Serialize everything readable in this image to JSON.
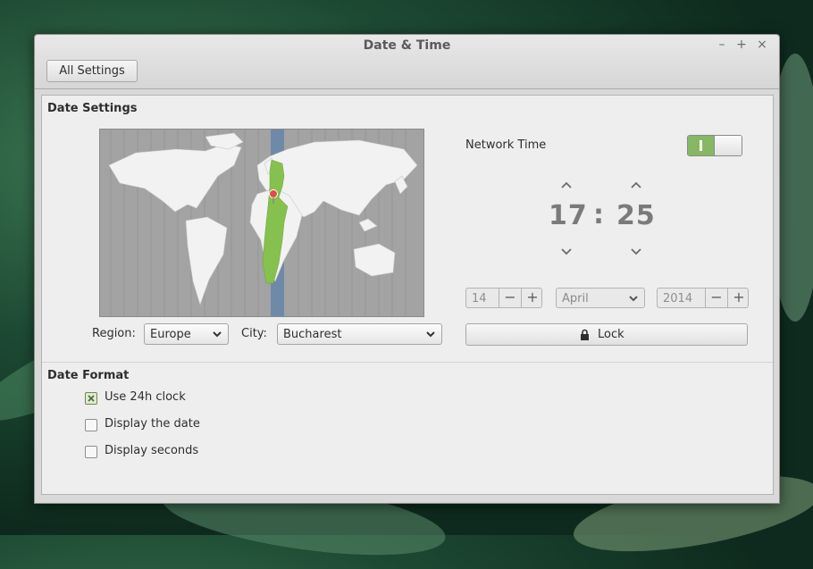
{
  "window": {
    "title": "Date & Time",
    "controls": {
      "minimize": "–",
      "maximize": "+",
      "close": "×"
    }
  },
  "header": {
    "all_settings_label": "All Settings"
  },
  "date_settings": {
    "title": "Date Settings",
    "region_label": "Region:",
    "region_value": "Europe",
    "city_label": "City:",
    "city_value": "Bucharest",
    "network_time_label": "Network Time",
    "network_time_on": true,
    "time": {
      "hours": "17",
      "separator": ":",
      "minutes": "25"
    },
    "day": "14",
    "month": "April",
    "year": "2014",
    "lock_label": "Lock"
  },
  "date_format": {
    "title": "Date Format",
    "options": [
      {
        "label": "Use 24h clock",
        "checked": true
      },
      {
        "label": "Display the date",
        "checked": false
      },
      {
        "label": "Display seconds",
        "checked": false
      }
    ]
  },
  "colors": {
    "accent": "#86b864",
    "map_land": "#f2f2f2",
    "map_ocean": "#a3a3a3",
    "timezone_band": "#6f89a9",
    "timezone_highlight": "#86c14f",
    "pin": "#e04b4b"
  },
  "icons": [
    "chevron-down-icon",
    "chevron-up-icon",
    "minus-icon",
    "plus-icon",
    "lock-icon",
    "check-icon",
    "map-pin-icon"
  ]
}
